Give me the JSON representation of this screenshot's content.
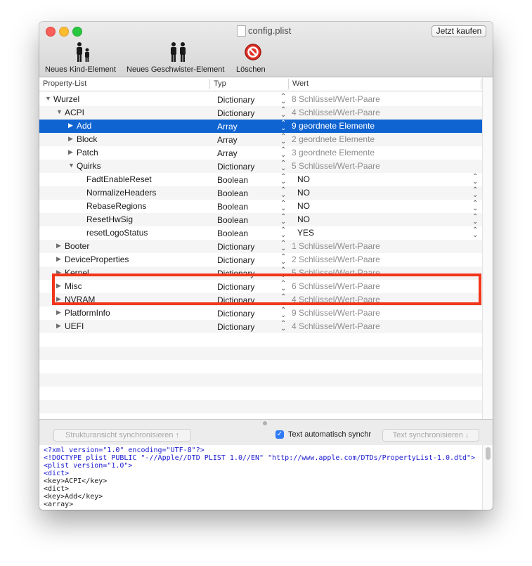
{
  "window": {
    "title": "config.plist",
    "buy_button": "Jetzt kaufen"
  },
  "toolbar": {
    "items": [
      {
        "label": "Neues Kind-Element",
        "icon": "child-element-icon"
      },
      {
        "label": "Neues Geschwister-Element",
        "icon": "sibling-element-icon"
      },
      {
        "label": "Löschen",
        "icon": "delete-icon"
      }
    ]
  },
  "columns": {
    "property_list": "Property-List",
    "type": "Typ",
    "value": "Wert"
  },
  "rows": [
    {
      "key": "Wurzel",
      "type": "Dictionary",
      "value": "8 Schlüssel/Wert-Paare",
      "indent": 0,
      "expander": "open"
    },
    {
      "key": "ACPI",
      "type": "Dictionary",
      "value": "4 Schlüssel/Wert-Paare",
      "indent": 1,
      "expander": "open"
    },
    {
      "key": "Add",
      "type": "Array",
      "value": "9 geordnete Elemente",
      "indent": 2,
      "expander": "closed",
      "selected": true
    },
    {
      "key": "Block",
      "type": "Array",
      "value": "2 geordnete Elemente",
      "indent": 2,
      "expander": "closed"
    },
    {
      "key": "Patch",
      "type": "Array",
      "value": "3 geordnete Elemente",
      "indent": 2,
      "expander": "closed"
    },
    {
      "key": "Quirks",
      "type": "Dictionary",
      "value": "5 Schlüssel/Wert-Paare",
      "indent": 2,
      "expander": "open"
    },
    {
      "key": "FadtEnableReset",
      "type": "Boolean",
      "value": "NO",
      "indent": 3,
      "expander": "none"
    },
    {
      "key": "NormalizeHeaders",
      "type": "Boolean",
      "value": "NO",
      "indent": 3,
      "expander": "none"
    },
    {
      "key": "RebaseRegions",
      "type": "Boolean",
      "value": "NO",
      "indent": 3,
      "expander": "none"
    },
    {
      "key": "ResetHwSig",
      "type": "Boolean",
      "value": "NO",
      "indent": 3,
      "expander": "none"
    },
    {
      "key": "resetLogoStatus",
      "type": "Boolean",
      "value": "YES",
      "indent": 3,
      "expander": "none"
    },
    {
      "key": "Booter",
      "type": "Dictionary",
      "value": "1 Schlüssel/Wert-Paare",
      "indent": 1,
      "expander": "closed"
    },
    {
      "key": "DeviceProperties",
      "type": "Dictionary",
      "value": "2 Schlüssel/Wert-Paare",
      "indent": 1,
      "expander": "closed"
    },
    {
      "key": "Kernel",
      "type": "Dictionary",
      "value": "5 Schlüssel/Wert-Paare",
      "indent": 1,
      "expander": "closed"
    },
    {
      "key": "Misc",
      "type": "Dictionary",
      "value": "6 Schlüssel/Wert-Paare",
      "indent": 1,
      "expander": "closed"
    },
    {
      "key": "NVRAM",
      "type": "Dictionary",
      "value": "4 Schlüssel/Wert-Paare",
      "indent": 1,
      "expander": "closed"
    },
    {
      "key": "PlatformInfo",
      "type": "Dictionary",
      "value": "9 Schlüssel/Wert-Paare",
      "indent": 1,
      "expander": "closed"
    },
    {
      "key": "UEFI",
      "type": "Dictionary",
      "value": "4 Schlüssel/Wert-Paare",
      "indent": 1,
      "expander": "closed"
    }
  ],
  "bottom_bar": {
    "sync_structure": "Strukturansicht synchronisieren ↑",
    "auto_text": "Text automatisch synchr",
    "auto_text_checked": true,
    "sync_text": "Text synchronisieren ↓"
  },
  "xml_lines": [
    "<?xml version=\"1.0\" encoding=\"UTF-8\"?>",
    "<!DOCTYPE plist PUBLIC \"-//Apple//DTD PLIST 1.0//EN\" \"http://www.apple.com/DTDs/PropertyList-1.0.dtd\">",
    "<plist version=\"1.0\">",
    "<dict>",
    "    <key>ACPI</key>",
    "    <dict>",
    "        <key>Add</key>",
    "        <array>"
  ],
  "colors": {
    "selection": "#0f64d2",
    "highlight_box": "#f2361b"
  }
}
